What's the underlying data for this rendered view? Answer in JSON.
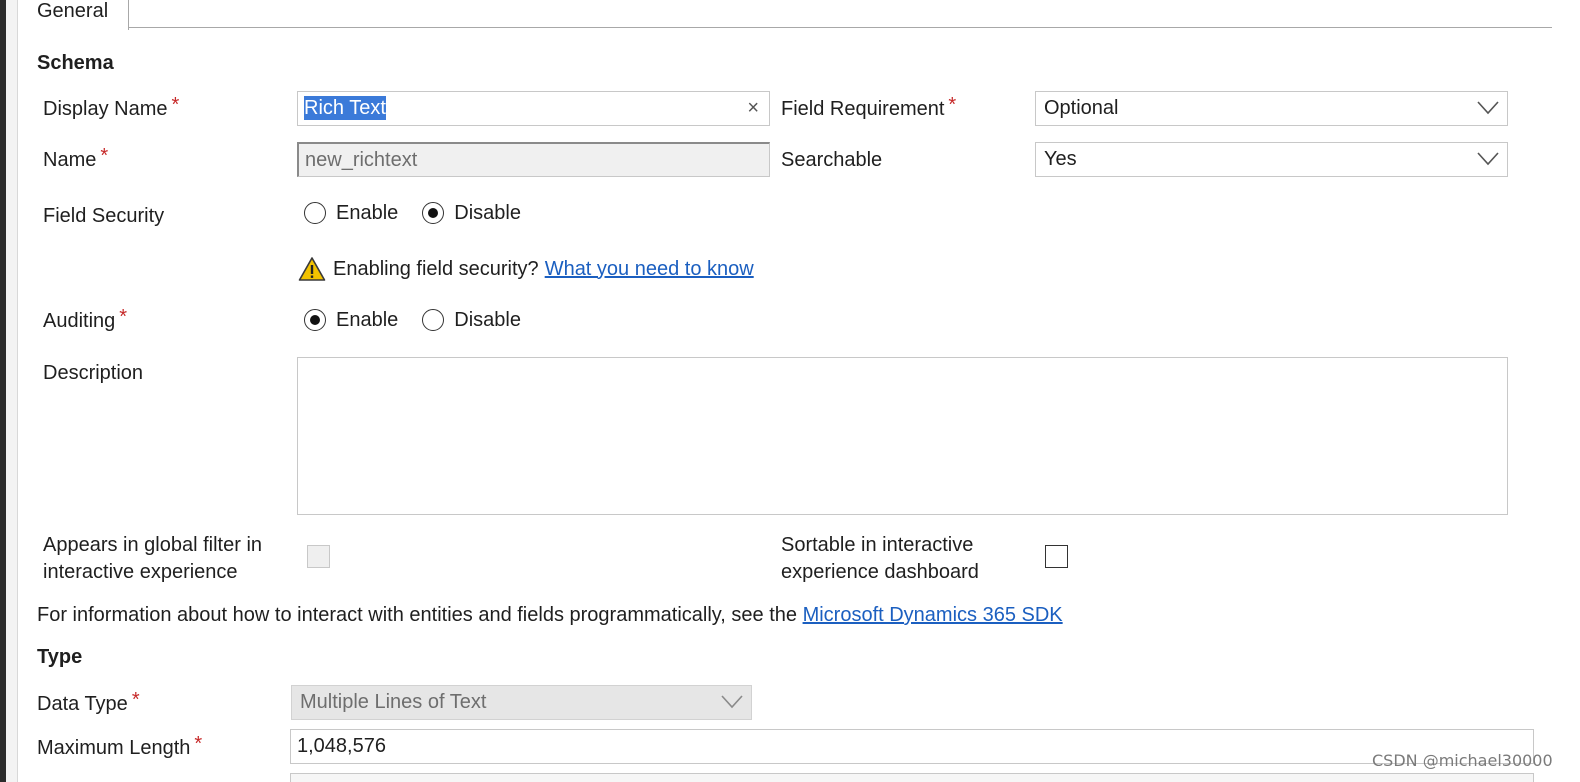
{
  "tabs": [
    {
      "label": "General"
    }
  ],
  "schema": {
    "heading": "Schema",
    "display_name": {
      "label": "Display Name",
      "value": "Rich Text",
      "clear_glyph": "×"
    },
    "name": {
      "label": "Name",
      "value": "new_richtext"
    },
    "field_requirement": {
      "label": "Field Requirement",
      "value": "Optional"
    },
    "searchable": {
      "label": "Searchable",
      "value": "Yes"
    },
    "field_security": {
      "label": "Field Security",
      "options": [
        {
          "label": "Enable",
          "checked": false
        },
        {
          "label": "Disable",
          "checked": true
        }
      ]
    },
    "security_warning": {
      "text": "Enabling field security?",
      "link": "What you need to know"
    },
    "auditing": {
      "label": "Auditing",
      "options": [
        {
          "label": "Enable",
          "checked": true
        },
        {
          "label": "Disable",
          "checked": false
        }
      ]
    },
    "description": {
      "label": "Description",
      "value": ""
    },
    "global_filter": {
      "label_line1": "Appears in global filter in",
      "label_line2": "interactive experience",
      "checked": false,
      "disabled": true
    },
    "sortable": {
      "label_line1": "Sortable in interactive",
      "label_line2": "experience dashboard",
      "checked": false
    },
    "sdk_info": {
      "text": "For information about how to interact with entities and fields programmatically, see the",
      "link": "Microsoft Dynamics 365 SDK"
    }
  },
  "type_section": {
    "heading": "Type",
    "data_type": {
      "label": "Data Type",
      "value": "Multiple Lines of Text"
    },
    "max_length": {
      "label": "Maximum Length",
      "value": "1,048,576"
    }
  },
  "required_marker": "*",
  "watermark": "CSDN @michael30000",
  "colors": {
    "link": "#1b5fc0",
    "required": "#c62828",
    "selection": "#3b7ad9",
    "warning": "#f2c200"
  },
  "icons": [
    "warning-icon",
    "chevron-down-icon",
    "clear-icon"
  ]
}
